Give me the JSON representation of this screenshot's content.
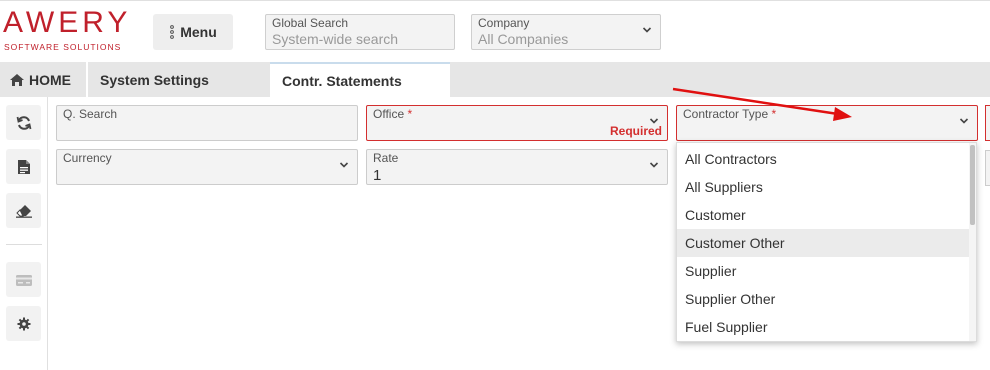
{
  "logo": {
    "main": "AWERY",
    "sub": "SOFTWARE SOLUTIONS"
  },
  "header": {
    "menu_label": "Menu",
    "global_search": {
      "label": "Global Search",
      "placeholder": "System-wide search"
    },
    "company": {
      "label": "Company",
      "value": "All Companies"
    }
  },
  "tabs": [
    {
      "label": "HOME",
      "icon": "home-icon"
    },
    {
      "label": "System Settings"
    },
    {
      "label": "Contr. Statements",
      "active": true
    }
  ],
  "sidebar": {
    "buttons": [
      "refresh-icon",
      "document-icon",
      "eraser-icon",
      "card-icon",
      "gear-icon"
    ]
  },
  "form": {
    "q_search": {
      "label": "Q. Search",
      "value": ""
    },
    "office": {
      "label": "Office",
      "required_mark": "*",
      "required_text": "Required",
      "value": ""
    },
    "contractor_type": {
      "label": "Contractor Type",
      "required_mark": "*",
      "value": ""
    },
    "currency": {
      "label": "Currency",
      "value": ""
    },
    "rate": {
      "label": "Rate",
      "value": "1"
    }
  },
  "contractor_type_options": [
    "All Contractors",
    "All Suppliers",
    "Customer",
    "Customer Other",
    "Supplier",
    "Supplier Other",
    "Fuel Supplier"
  ],
  "highlighted_option": "Customer Other",
  "colors": {
    "brand": "#c0202b",
    "required": "#d32f2f",
    "annotation_arrow": "#e01010"
  }
}
